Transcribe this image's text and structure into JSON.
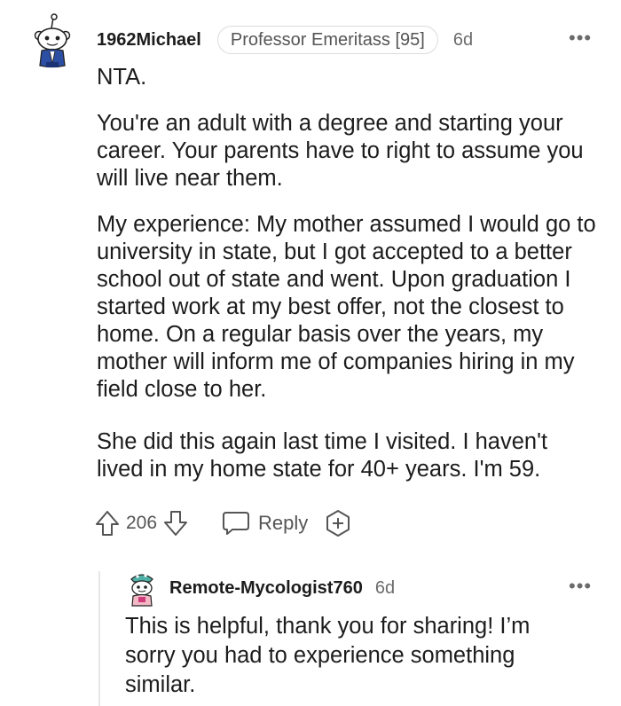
{
  "comment": {
    "username": "1962Michael",
    "flair": "Professor Emeritass [95]",
    "time": "6d",
    "more": "•••",
    "paragraphs": [
      "NTA.",
      "You're an adult with a degree and starting your career. Your parents have to right to assume you will live near them.",
      "My experience: My mother assumed I would go to university in state, but I got accepted to a better school out of state and went. Upon graduation I started work at my best offer, not the closest to home. On a regular basis over the years, my mother will inform me of companies hiring in my field close to her.",
      "She did this again last time I visited. I haven't lived in my home state for 40+ years. I'm 59."
    ],
    "votes": "206",
    "reply_label": "Reply"
  },
  "reply": {
    "username": "Remote-Mycologist760",
    "time": "6d",
    "more": "•••",
    "text": "This is helpful, thank you for sharing! I’m sorry you had to experience something similar."
  },
  "icons": {
    "upvote": "upvote-arrow-icon",
    "downvote": "downvote-arrow-icon",
    "reply": "speech-bubble-icon",
    "award": "award-plus-icon",
    "more": "ellipsis-icon"
  }
}
